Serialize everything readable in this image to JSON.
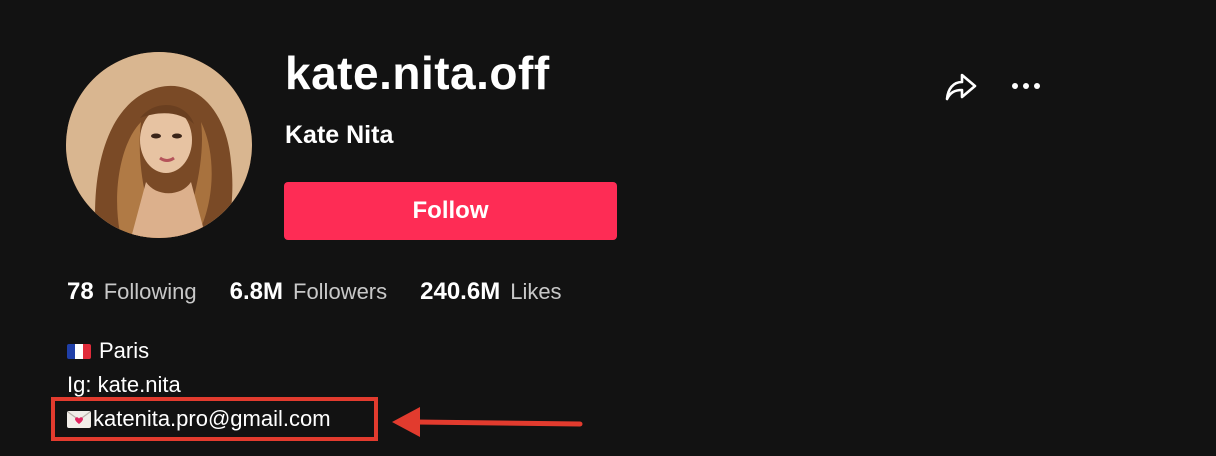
{
  "profile": {
    "username": "kate.nita.off",
    "display_name": "Kate Nita",
    "follow_label": "Follow"
  },
  "stats": [
    {
      "value": "78",
      "label": "Following"
    },
    {
      "value": "6.8M",
      "label": "Followers"
    },
    {
      "value": "240.6M",
      "label": "Likes"
    }
  ],
  "bio": {
    "location": "Paris",
    "instagram": "Ig: kate.nita",
    "email": "katenita.pro@gmail.com"
  },
  "icons": {
    "share": "share-icon",
    "more": "more-options-icon",
    "flag": "france-flag-icon",
    "envelope": "love-letter-icon"
  },
  "colors": {
    "background": "#121212",
    "follow_button": "#fe2c55",
    "annotation": "#e23b2e"
  }
}
